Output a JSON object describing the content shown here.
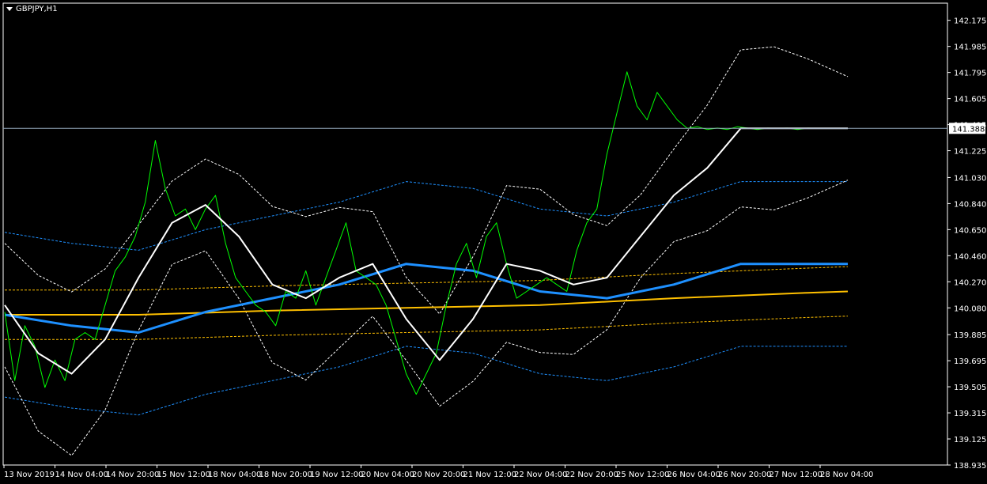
{
  "window": {
    "symbol_label": "GBPJPY,H1"
  },
  "colors": {
    "background": "#000000",
    "axis": "#ffffff",
    "price": "#00ff00",
    "ma_fast": "#ffffff",
    "ma_mid": "#1e90ff",
    "ma_slow": "#ffc000",
    "band_fast": "#ffffff",
    "band_mid": "#1e90ff",
    "band_slow": "#ffc000",
    "current_line": "#8fa4b8"
  },
  "chart_data": {
    "type": "line",
    "title": "GBPJPY,H1",
    "ylim": [
      138.935,
      142.3
    ],
    "y_ticks": [
      "142.175",
      "141.985",
      "141.795",
      "141.605",
      "141.415",
      "141.225",
      "141.030",
      "140.840",
      "140.650",
      "140.460",
      "140.270",
      "140.080",
      "139.885",
      "139.695",
      "139.505",
      "139.315",
      "139.125",
      "138.935"
    ],
    "x_tick_labels": [
      "13 Nov 2019",
      "14 Nov 04:00",
      "14 Nov 20:00",
      "15 Nov 12:00",
      "18 Nov 04:00",
      "18 Nov 20:00",
      "19 Nov 12:00",
      "20 Nov 04:00",
      "20 Nov 20:00",
      "21 Nov 12:00",
      "22 Nov 04:00",
      "22 Nov 20:00",
      "25 Nov 12:00",
      "26 Nov 04:00",
      "26 Nov 20:00",
      "27 Nov 12:00",
      "28 Nov 04:00"
    ],
    "current_price": 141.388,
    "current_price_label": "141.388",
    "series": [
      {
        "role": "price",
        "x": [
          0,
          3,
          6,
          9,
          12,
          15,
          18,
          21,
          24,
          27,
          30,
          33,
          36,
          39,
          42,
          45,
          48,
          51,
          54,
          57,
          60,
          63,
          66,
          69,
          72,
          75,
          78,
          81,
          84,
          87,
          90,
          93,
          96,
          99,
          102,
          105,
          108,
          111,
          114,
          117,
          120,
          123,
          126,
          129,
          132,
          135,
          138,
          141,
          144,
          147,
          150,
          153,
          156,
          159,
          162,
          165,
          168,
          171,
          174,
          177,
          180,
          183,
          186,
          189,
          192,
          195,
          198,
          201,
          204,
          207,
          210,
          213,
          216,
          219,
          222,
          225,
          228,
          231,
          234,
          237,
          240,
          243,
          246,
          249,
          252
        ],
        "values": [
          140.05,
          139.55,
          139.95,
          139.8,
          139.5,
          139.7,
          139.55,
          139.85,
          139.9,
          139.85,
          140.1,
          140.35,
          140.45,
          140.6,
          140.85,
          141.3,
          140.95,
          140.75,
          140.8,
          140.65,
          140.8,
          140.9,
          140.55,
          140.3,
          140.2,
          140.1,
          140.05,
          139.95,
          140.2,
          140.15,
          140.35,
          140.1,
          140.3,
          140.5,
          140.7,
          140.35,
          140.3,
          140.25,
          140.1,
          139.85,
          139.6,
          139.45,
          139.6,
          139.75,
          140.1,
          140.4,
          140.55,
          140.3,
          140.6,
          140.7,
          140.4,
          140.15,
          140.2,
          140.25,
          140.3,
          140.25,
          140.2,
          140.5,
          140.7,
          140.8,
          141.2,
          141.5,
          141.8,
          141.55,
          141.45,
          141.65,
          141.55,
          141.45,
          141.388,
          141.4,
          141.38,
          141.39,
          141.38,
          141.4,
          141.39,
          141.38,
          141.39,
          141.388,
          141.39,
          141.38,
          141.39,
          141.388,
          141.388,
          141.388,
          141.388
        ]
      },
      {
        "role": "ma_fast",
        "x": [
          0,
          10,
          20,
          30,
          40,
          50,
          60,
          70,
          80,
          90,
          100,
          110,
          120,
          130,
          140,
          150,
          160,
          170,
          180,
          190,
          200,
          210,
          220,
          230,
          240,
          252
        ],
        "values": [
          140.1,
          139.75,
          139.6,
          139.85,
          140.3,
          140.7,
          140.83,
          140.6,
          140.25,
          140.15,
          140.3,
          140.4,
          140.0,
          139.7,
          140.0,
          140.4,
          140.35,
          140.25,
          140.3,
          140.6,
          140.9,
          141.1,
          141.388,
          141.388,
          141.388,
          141.388
        ]
      },
      {
        "role": "ma_mid",
        "x": [
          0,
          20,
          40,
          60,
          80,
          100,
          120,
          140,
          160,
          180,
          200,
          220,
          240,
          252
        ],
        "values": [
          140.03,
          139.95,
          139.9,
          140.05,
          140.15,
          140.25,
          140.4,
          140.35,
          140.2,
          140.15,
          140.25,
          140.4,
          140.4,
          140.4
        ]
      },
      {
        "role": "ma_slow",
        "x": [
          0,
          40,
          80,
          120,
          160,
          200,
          240,
          252
        ],
        "values": [
          140.03,
          140.03,
          140.06,
          140.08,
          140.1,
          140.15,
          140.19,
          140.2
        ]
      }
    ]
  }
}
